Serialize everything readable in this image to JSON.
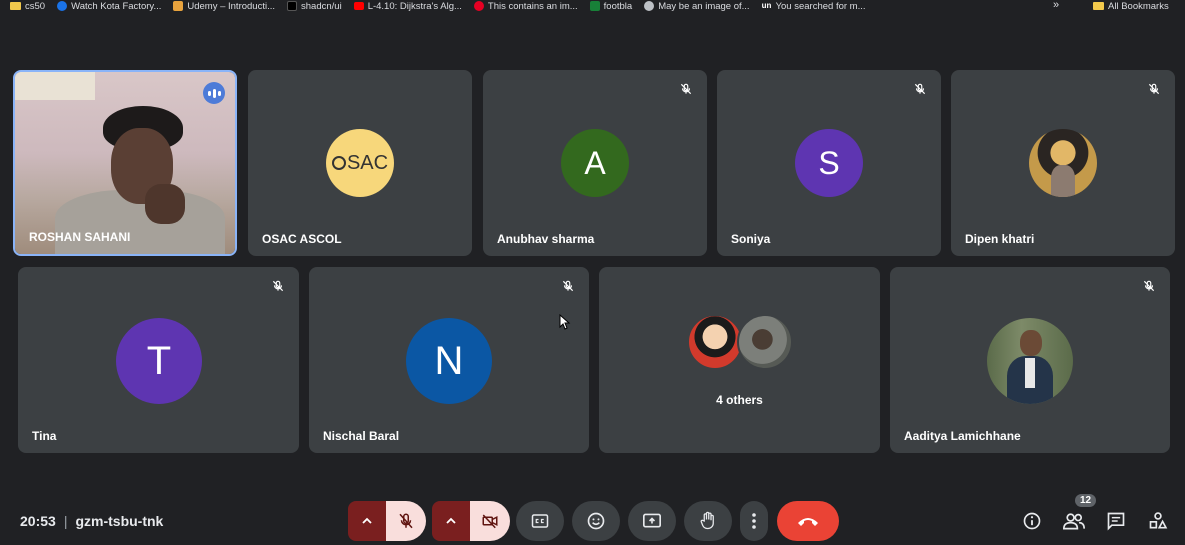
{
  "bookmarks": [
    {
      "label": "cs50",
      "icon": "folder-icon",
      "color": "#f2c94c"
    },
    {
      "label": "Watch Kota Factory...",
      "icon": "site-icon",
      "color": "#1a73e8"
    },
    {
      "label": "Udemy – Introducti...",
      "icon": "udemy-icon",
      "color": "#e8a33d"
    },
    {
      "label": "shadcn/ui",
      "icon": "shadcn-icon",
      "color": "#000000"
    },
    {
      "label": "L-4.10: Dijkstra's Alg...",
      "icon": "youtube-icon",
      "color": "#ff0000"
    },
    {
      "label": "This contains an im...",
      "icon": "pinterest-icon",
      "color": "#e60023"
    },
    {
      "label": "footbla",
      "icon": "sheet-icon",
      "color": "#188038"
    },
    {
      "label": "May be an image of...",
      "icon": "globe-icon",
      "color": "#bdc1c6"
    },
    {
      "label": "You searched for m...",
      "icon": "un-icon",
      "color": "#202124"
    }
  ],
  "bookmarks_more": "»",
  "all_bookmarks": "All Bookmarks",
  "tiles": [
    {
      "name": "ROSHAN SAHANI",
      "type": "video",
      "speaking": true
    },
    {
      "name": "OSAC ASCOL",
      "type": "logo",
      "logo_text": "SAC",
      "color": "#f7d77b"
    },
    {
      "name": "Anubhav sharma",
      "type": "letter",
      "letter": "A",
      "color": "#33691e",
      "muted": true
    },
    {
      "name": "Soniya",
      "type": "letter",
      "letter": "S",
      "color": "#5e35b1",
      "muted": true
    },
    {
      "name": "Dipen khatri",
      "type": "photo",
      "color": "#c49a4a",
      "muted": true
    },
    {
      "name": "Tina",
      "type": "letter",
      "letter": "T",
      "color": "#5e35b1",
      "muted": true
    },
    {
      "name": "Nischal Baral",
      "type": "letter",
      "letter": "N",
      "color": "#0b57a4",
      "muted": true
    },
    {
      "name": "4 others",
      "type": "group"
    },
    {
      "name": "Aaditya Lamichhane",
      "type": "photo",
      "color": "#5b6b4a",
      "muted": true
    }
  ],
  "meeting": {
    "time": "20:53",
    "separator": "|",
    "code": "gzm-tsbu-tnk"
  },
  "participants_count": "12",
  "colors": {
    "background": "#202124",
    "tile": "#3c4043",
    "active_border": "#8ab4f8",
    "end_call": "#ea4335",
    "muted_button": "#f9dedc"
  }
}
